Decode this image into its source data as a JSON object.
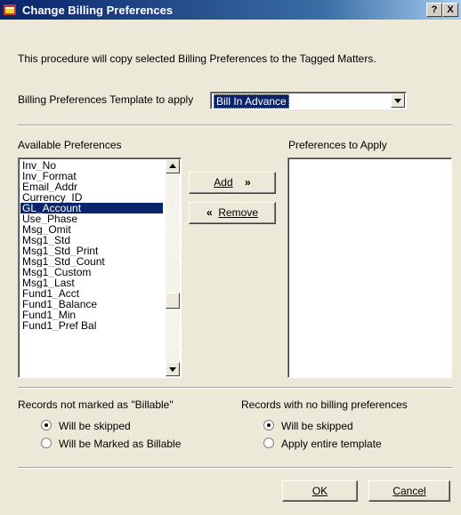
{
  "window": {
    "title": "Change Billing Preferences",
    "help_button": "?",
    "close_button": "X"
  },
  "intro": "This procedure will copy selected Billing Preferences to the Tagged Matters.",
  "template": {
    "label": "Billing Preferences Template to apply",
    "value": "Bill In Advance"
  },
  "available": {
    "label": "Available Preferences",
    "items": [
      "Inv_No",
      "Inv_Format",
      "Email_Addr",
      "Currency_ID",
      "GL_Account",
      "Use_Phase",
      "Msg_Omit",
      "Msg1_Std",
      "Msg1_Std_Print",
      "Msg1_Std_Count",
      "Msg1_Custom",
      "Msg1_Last",
      "Fund1_Acct",
      "Fund1_Balance",
      "Fund1_Min",
      "Fund1_Pref Bal"
    ],
    "selected": "GL_Account"
  },
  "apply": {
    "label": "Preferences to Apply"
  },
  "buttons": {
    "add_label": "Add",
    "add_glyph": "»",
    "remove_glyph": "«",
    "remove_label": "Remove",
    "ok_label": "OK",
    "cancel_label": "Cancel"
  },
  "not_billable": {
    "label": "Records not marked as \"Billable\"",
    "options": [
      "Will be skipped",
      "Will be Marked as Billable"
    ],
    "selected_index": 0
  },
  "no_prefs": {
    "label": "Records with no billing preferences",
    "options": [
      "Will be skipped",
      "Apply entire template"
    ],
    "selected_index": 0
  }
}
